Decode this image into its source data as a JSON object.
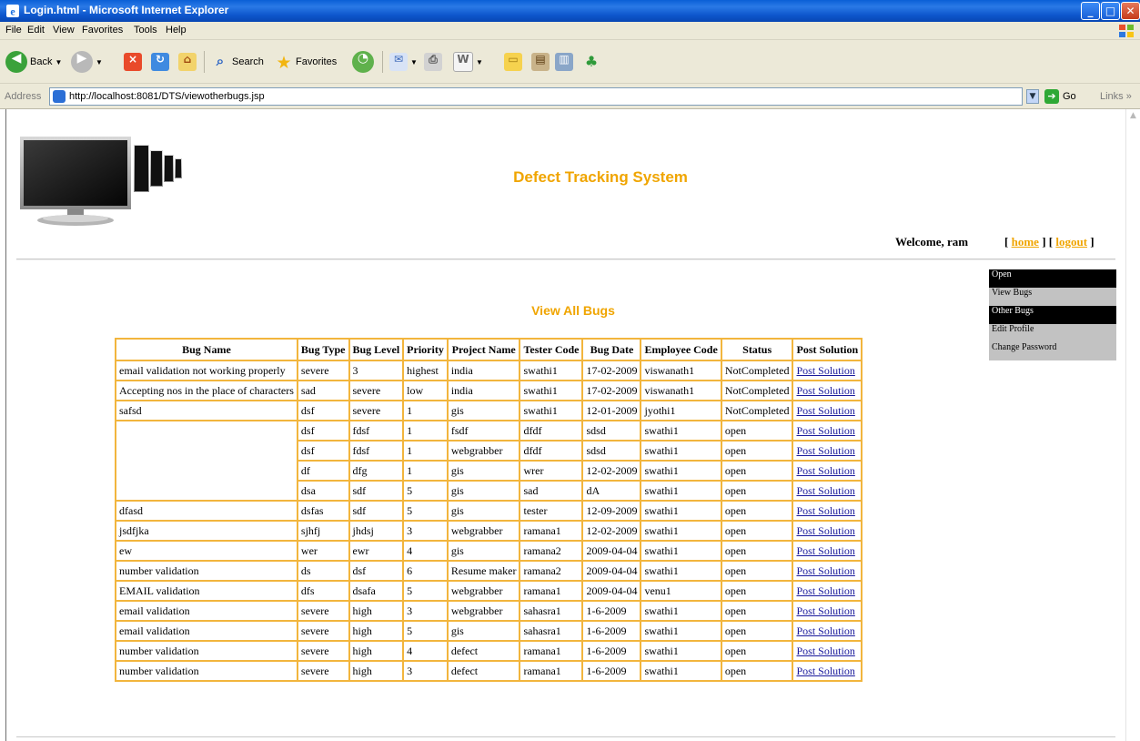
{
  "window": {
    "title": "Login.html - Microsoft Internet Explorer",
    "controls": {
      "minimize": "_",
      "maximize": "□",
      "close": "✕"
    }
  },
  "menubar": [
    "File",
    "Edit",
    "View",
    "Favorites",
    "Tools",
    "Help"
  ],
  "toolbar": {
    "back_label": "Back",
    "search_label": "Search",
    "favorites_label": "Favorites"
  },
  "addressbar": {
    "label": "Address",
    "url": "http://localhost:8081/DTS/viewotherbugs.jsp",
    "go_label": "Go",
    "links_label": "Links »"
  },
  "header": {
    "site_title": "Defect Tracking System",
    "welcome": "Welcome,  ram",
    "home_link": "home",
    "logout_link": "logout"
  },
  "sidemenu": [
    {
      "label": "Open",
      "style": "dark"
    },
    {
      "label": "View Bugs",
      "style": "grey"
    },
    {
      "label": "Other Bugs",
      "style": "dark"
    },
    {
      "label": "Edit Profile",
      "style": "grey"
    },
    {
      "label": "Change Password",
      "style": "grey"
    }
  ],
  "main": {
    "title": "View All Bugs",
    "columns": [
      "Bug Name",
      "Bug Type",
      "Bug Level",
      "Priority",
      "Project Name",
      "Tester Code",
      "Bug Date",
      "Employee Code",
      "Status",
      "Post Solution"
    ],
    "link_label": "Post Solution",
    "rows": [
      [
        "email validation not working properly",
        "severe",
        "3",
        "highest",
        "india",
        "swathi1",
        "17-02-2009",
        "viswanath1",
        "NotCompleted"
      ],
      [
        "Accepting nos in the place of characters",
        "sad",
        "severe",
        "low",
        "india",
        "swathi1",
        "17-02-2009",
        "viswanath1",
        "NotCompleted"
      ],
      [
        "safsd",
        "dsf",
        "severe",
        "1",
        "gis",
        "swathi1",
        "12-01-2009",
        "jyothi1",
        "NotCompleted"
      ],
      [
        "",
        "dsf",
        "fdsf",
        "1",
        "fsdf",
        "dfdf",
        "sdsd",
        "swathi1",
        "open"
      ],
      [
        "",
        "dsf",
        "fdsf",
        "1",
        "webgrabber",
        "dfdf",
        "sdsd",
        "swathi1",
        "open"
      ],
      [
        "",
        "df",
        "dfg",
        "1",
        "gis",
        "wrer",
        "12-02-2009",
        "swathi1",
        "open"
      ],
      [
        "",
        "dsa",
        "sdf",
        "5",
        "gis",
        "sad",
        "dA",
        "swathi1",
        "open"
      ],
      [
        "dfasd",
        "dsfas",
        "sdf",
        "5",
        "gis",
        "tester",
        "12-09-2009",
        "swathi1",
        "open"
      ],
      [
        "jsdfjka",
        "sjhfj",
        "jhdsj",
        "3",
        "webgrabber",
        "ramana1",
        "12-02-2009",
        "swathi1",
        "open"
      ],
      [
        "ew",
        "wer",
        "ewr",
        "4",
        "gis",
        "ramana2",
        "2009-04-04",
        "swathi1",
        "open"
      ],
      [
        "number validation",
        "ds",
        "dsf",
        "6",
        "Resume maker",
        "ramana2",
        "2009-04-04",
        "swathi1",
        "open"
      ],
      [
        "EMAIL validation",
        "dfs",
        "dsafa",
        "5",
        "webgrabber",
        "ramana1",
        "2009-04-04",
        "venu1",
        "open"
      ],
      [
        "email validation",
        "severe",
        "high",
        "3",
        "webgrabber",
        "sahasra1",
        "1-6-2009",
        "swathi1",
        "open"
      ],
      [
        "email validation",
        "severe",
        "high",
        "5",
        "gis",
        "sahasra1",
        "1-6-2009",
        "swathi1",
        "open"
      ],
      [
        "number validation",
        "severe",
        "high",
        "4",
        "defect",
        "ramana1",
        "1-6-2009",
        "swathi1",
        "open"
      ],
      [
        "number validation",
        "severe",
        "high",
        "3",
        "defect",
        "ramana1",
        "1-6-2009",
        "swathi1",
        "open"
      ]
    ]
  },
  "colors": {
    "accent": "#f0a500",
    "table_border": "#f2b53d",
    "link": "#1a1a9c",
    "titlebar": "#0a5fd6"
  }
}
